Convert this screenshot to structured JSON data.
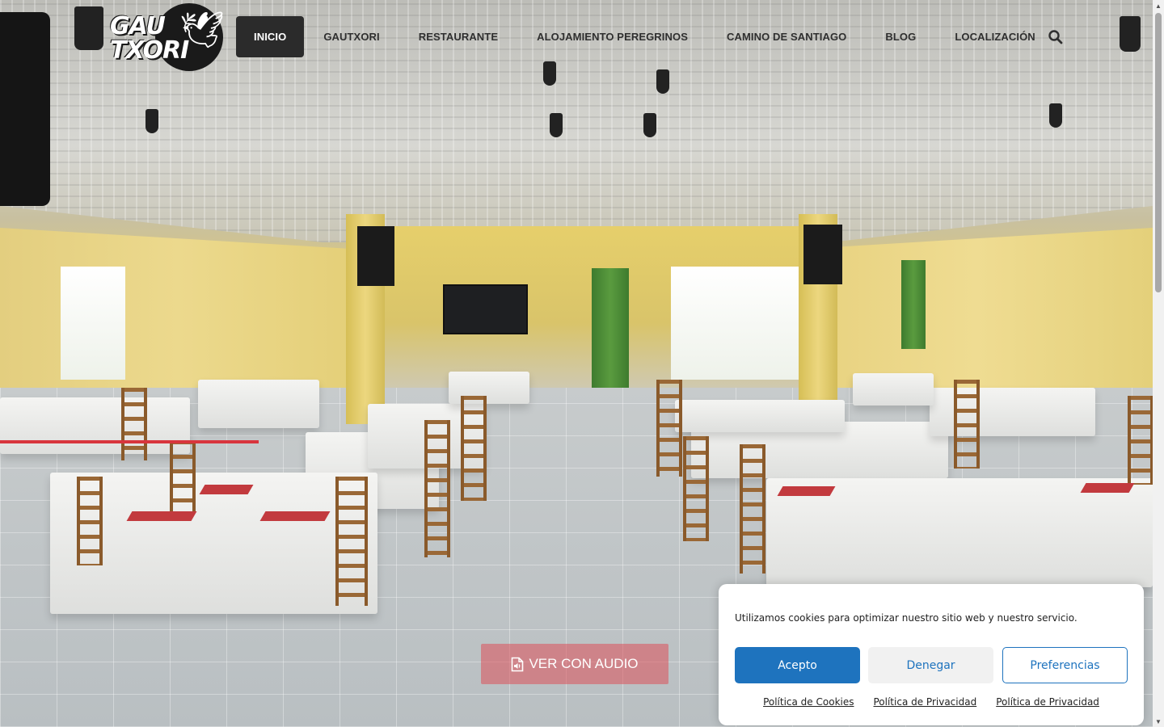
{
  "logo": {
    "text_line1": "GAU",
    "text_line2": "TXORI"
  },
  "nav": {
    "items": [
      {
        "label": "INICIO"
      },
      {
        "label": "GAUTXORI"
      },
      {
        "label": "RESTAURANTE"
      },
      {
        "label": "ALOJAMIENTO PEREGRINOS"
      },
      {
        "label": "CAMINO DE SANTIAGO"
      },
      {
        "label": "BLOG"
      },
      {
        "label": "LOCALIZACIÓN"
      }
    ],
    "active_index": 0,
    "search_icon": "search-icon"
  },
  "hero": {
    "audio_button_label": "VER CON AUDIO",
    "audio_button_icon": "audio-file-icon"
  },
  "cookie_banner": {
    "message": "Utilizamos cookies para optimizar nuestro sitio web y nuestro servicio.",
    "accept_label": "Acepto",
    "deny_label": "Denegar",
    "preferences_label": "Preferencias",
    "links": [
      {
        "label": "Política de Cookies"
      },
      {
        "label": "Política de Privacidad"
      },
      {
        "label": "Política de Privacidad"
      }
    ]
  },
  "colors": {
    "nav_active_bg": "#2b2b2b",
    "accept_bg": "#1e73be",
    "link_blue": "#1e73be",
    "audio_button_bg": "#dc505a"
  }
}
